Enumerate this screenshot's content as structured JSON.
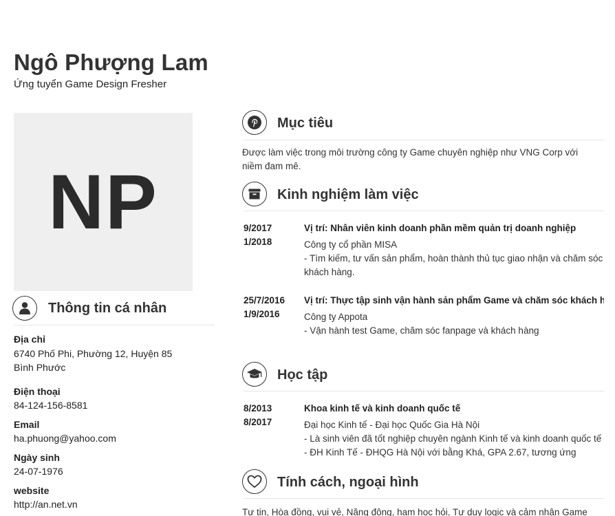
{
  "profile": {
    "name": "Ngô Phượng Lam",
    "subtitle": "Ứng tuyển Game Design Fresher",
    "initials": "NP"
  },
  "personal": {
    "title": "Thông tin cá nhân",
    "icon": "user-icon",
    "address_label": "Địa chỉ",
    "address_line1": "6740 Phố Phi, Phường 12, Huyện 85",
    "address_line2": "Bình Phước",
    "phone_label": "Điện thoại",
    "phone": "84-124-156-8581",
    "email_label": "Email",
    "email": "ha.phuong@yahoo.com",
    "dob_label": "Ngày sinh",
    "dob": "24-07-1976",
    "website_label": "website",
    "website": "http://an.net.vn"
  },
  "objective": {
    "title": "Mục tiêu",
    "icon": "pinterest-icon",
    "text": "Được làm việc trong môi trường công ty Game chuyên nghiệp như VNG Corp với niềm đam mê."
  },
  "experience": {
    "title": "Kinh nghiệm làm việc",
    "icon": "archive-icon",
    "items": [
      {
        "start": "9/2017",
        "end": "1/2018",
        "position": "Vị trí: Nhân viên kinh doanh phần mềm quản trị doanh nghiệp",
        "company": "Công ty cổ phần MISA",
        "desc": "- Tìm kiếm, tư vấn sản phẩm, hoàn thành thủ tục giao nhận và chăm sóc khách hàng."
      },
      {
        "start": "25/7/2016",
        "end": "1/9/2016",
        "position": "Vị trí: Thực tập sinh vận hành sản phẩm Game và chăm sóc khách hàng",
        "company": "Công ty Appota",
        "desc": "- Vận hành test Game, chăm sóc fanpage và khách hàng"
      }
    ]
  },
  "education": {
    "title": "Học tập",
    "icon": "graduation-cap-icon",
    "items": [
      {
        "start": "8/2013",
        "end": "8/2017",
        "major": "Khoa kinh tế và kinh doanh quốc tế",
        "school": "Đại học Kinh tế - Đại học Quốc Gia Hà Nội",
        "desc": "- Là sinh viên đã tốt nghiệp chuyên ngành Kinh tế và kinh doanh quốc tế - ĐH Kinh Tế - ĐHQG Hà Nội với bằng Khá, GPA 2.67, tương ứng"
      }
    ]
  },
  "personality": {
    "title": "Tính cách, ngoại hình",
    "icon": "heart-icon",
    "text": "Tự tin, Hòa đồng, vui vẻ, Năng động, ham học hỏi, Tư duy logic và cảm nhận Game"
  }
}
